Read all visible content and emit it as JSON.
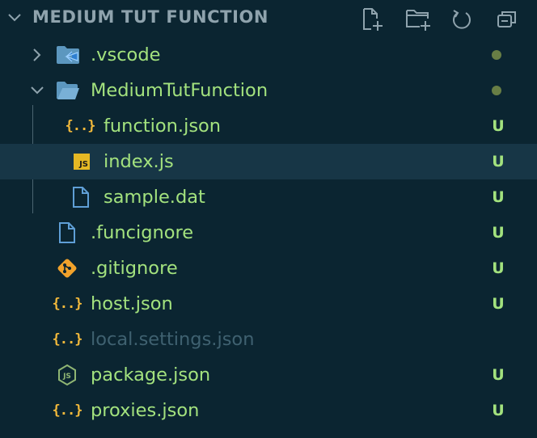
{
  "explorer": {
    "section_title": "MEDIUM TUT FUNCTION",
    "actions": [
      {
        "name": "new-file-icon"
      },
      {
        "name": "new-folder-icon"
      },
      {
        "name": "refresh-icon"
      },
      {
        "name": "collapse-all-icon"
      }
    ]
  },
  "colors": {
    "background": "#0b2531",
    "selected_row": "#173646",
    "untracked_text": "#a3e27e",
    "ignored_text": "#3f6170",
    "json_icon": "#f2b93b",
    "folder_icon": "#5c97bf",
    "file_icon": "#5f9fd6",
    "git_icon": "#f1a22b",
    "dot_decoration": "#687e45"
  },
  "tree": {
    "items": [
      {
        "label": ".vscode",
        "icon": "vscode-folder-icon",
        "type": "folder",
        "expanded": false,
        "status": "dot"
      },
      {
        "label": "MediumTutFunction",
        "icon": "open-folder-icon",
        "type": "folder",
        "expanded": true,
        "status": "dot"
      },
      {
        "label": "function.json",
        "icon": "json-icon",
        "type": "file",
        "status": "U"
      },
      {
        "label": "index.js",
        "icon": "javascript-icon",
        "type": "file",
        "status": "U",
        "selected": true
      },
      {
        "label": "sample.dat",
        "icon": "file-icon",
        "type": "file",
        "status": "U"
      },
      {
        "label": ".funcignore",
        "icon": "file-icon",
        "type": "file",
        "status": "U"
      },
      {
        "label": ".gitignore",
        "icon": "git-icon",
        "type": "file",
        "status": "U"
      },
      {
        "label": "host.json",
        "icon": "json-icon",
        "type": "file",
        "status": "U"
      },
      {
        "label": "local.settings.json",
        "icon": "json-icon",
        "type": "file",
        "status": "",
        "ignored": true
      },
      {
        "label": "package.json",
        "icon": "nodejs-icon",
        "type": "file",
        "status": "U"
      },
      {
        "label": "proxies.json",
        "icon": "json-icon",
        "type": "file",
        "status": "U"
      }
    ],
    "json_glyph": "{..}",
    "js_badge": "JS"
  }
}
